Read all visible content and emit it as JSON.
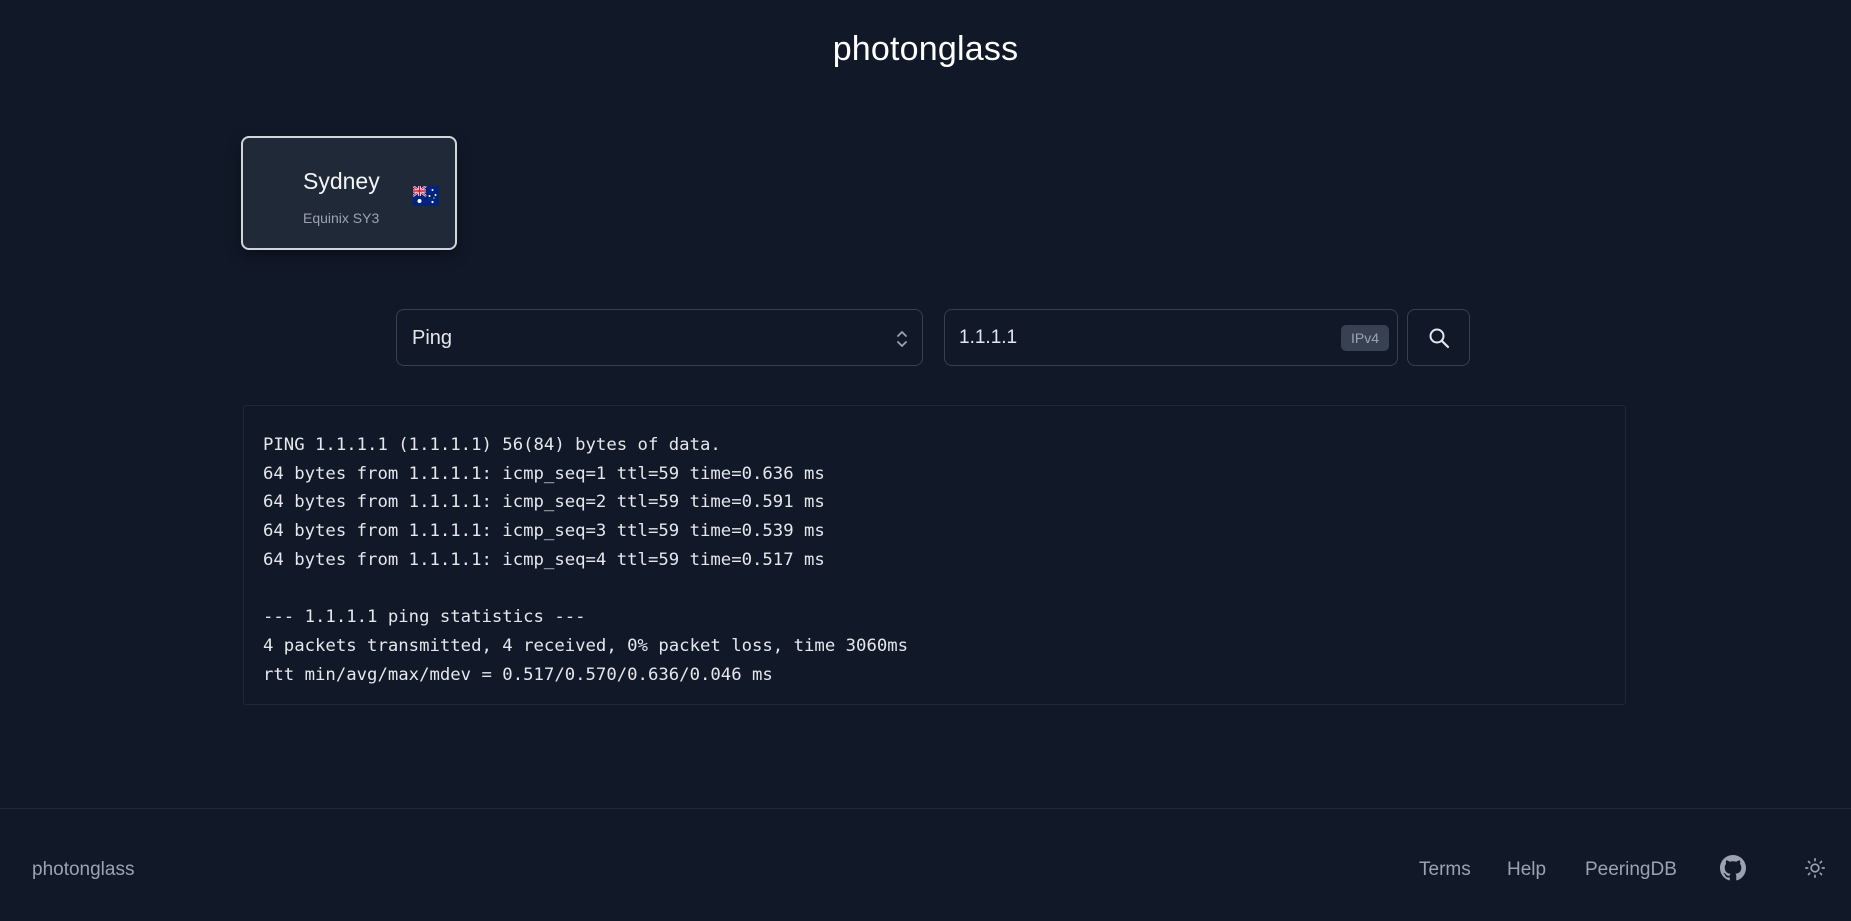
{
  "app": {
    "title": "photonglass"
  },
  "location": {
    "name": "Sydney",
    "facility": "Equinix SY3",
    "flag_icon": "australia-flag-icon"
  },
  "query": {
    "type_selected": "Ping",
    "target_value": "1.1.1.1",
    "ip_version_badge": "IPv4",
    "submit_icon": "search-icon"
  },
  "output": {
    "lines": "PING 1.1.1.1 (1.1.1.1) 56(84) bytes of data.\n64 bytes from 1.1.1.1: icmp_seq=1 ttl=59 time=0.636 ms\n64 bytes from 1.1.1.1: icmp_seq=2 ttl=59 time=0.591 ms\n64 bytes from 1.1.1.1: icmp_seq=3 ttl=59 time=0.539 ms\n64 bytes from 1.1.1.1: icmp_seq=4 ttl=59 time=0.517 ms\n\n--- 1.1.1.1 ping statistics ---\n4 packets transmitted, 4 received, 0% packet loss, time 3060ms\nrtt min/avg/max/mdev = 0.517/0.570/0.636/0.046 ms"
  },
  "footer": {
    "brand": "photonglass",
    "links": {
      "terms": "Terms",
      "help": "Help",
      "peeringdb": "PeeringDB"
    },
    "github_icon": "github-icon",
    "theme_icon": "sun-icon"
  },
  "colors": {
    "background": "#111827",
    "card": "#1f2937",
    "border": "#374151",
    "text": "#e5e7eb",
    "muted": "#9ca3af"
  }
}
